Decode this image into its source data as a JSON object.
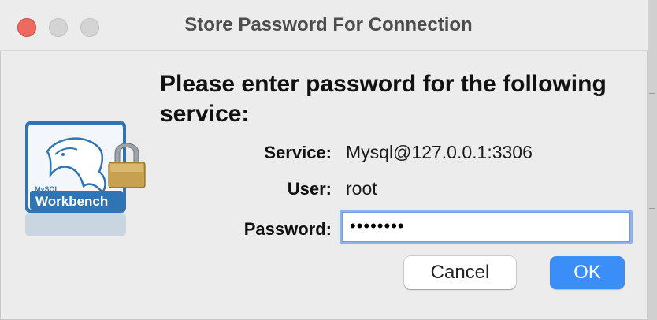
{
  "window": {
    "title": "Store Password For Connection",
    "traffic_lights": [
      "close",
      "minimize",
      "zoom"
    ]
  },
  "dialog": {
    "prompt": "Please enter password for the following service:",
    "service_label": "Service:",
    "service_value": "Mysql@127.0.0.1:3306",
    "user_label": "User:",
    "user_value": "root",
    "password_label": "Password:",
    "password_value": "••••••••",
    "cancel_label": "Cancel",
    "ok_label": "OK"
  },
  "logo": {
    "icon": "mysql-workbench-lock-icon",
    "brand_text": "MySQL",
    "product_text": "Workbench"
  },
  "colors": {
    "ok_button": "#3b8df7",
    "close_light": "#ed6a5e",
    "focus_ring": "#8fb2ea"
  }
}
